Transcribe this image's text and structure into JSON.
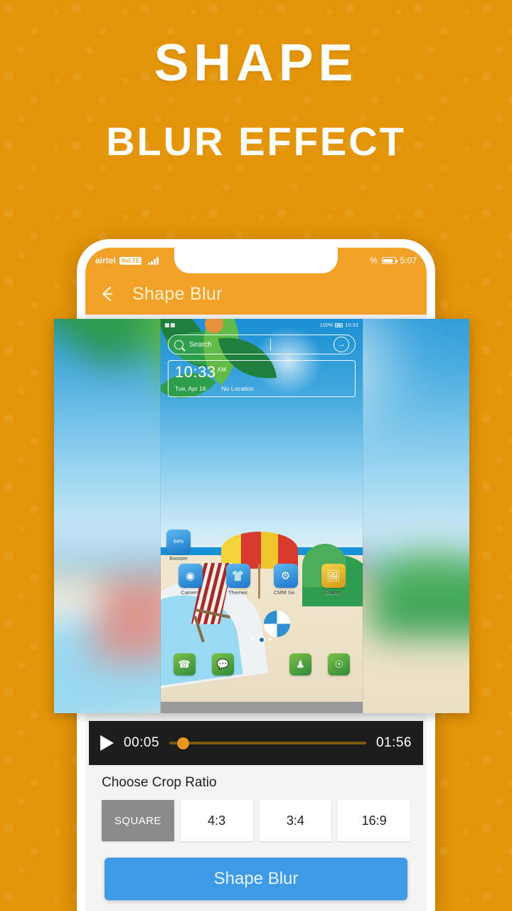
{
  "promo": {
    "headline": "SHAPE",
    "subheadline": "BLUR EFFECT",
    "background_color": "#e39408"
  },
  "phone": {
    "status_bar": {
      "carrier": "airtel",
      "volte": "VoLTE",
      "battery_text": "%",
      "time": "5:07"
    },
    "app_bar": {
      "back_icon": "arrow-left-icon",
      "title": "Shape Blur",
      "color": "#f3a229"
    }
  },
  "preview": {
    "inner_screenshot": {
      "status": {
        "battery": "100%",
        "time": "10:33"
      },
      "search": {
        "placeholder": "Search",
        "icon": "search-icon",
        "go_icon": "arrow-right-icon"
      },
      "clock_widget": {
        "time": "10:33",
        "meridiem": "AM",
        "date": "Tue, Apr 16",
        "location": "No Location"
      },
      "apps": [
        {
          "label": "Booster",
          "icon": "booster-icon",
          "badge": "64%"
        },
        {
          "label": "Camera",
          "icon": "camera-icon"
        },
        {
          "label": "Themes",
          "icon": "themes-icon"
        },
        {
          "label": "CMM Se..",
          "icon": "settings-gear-icon"
        },
        {
          "label": "Gallery",
          "icon": "gallery-icon"
        }
      ],
      "page_dots": {
        "count": 3,
        "active_index": 1
      },
      "dock": [
        {
          "icon": "phone-icon"
        },
        {
          "icon": "messages-icon"
        },
        {
          "icon": "app-drawer-icon"
        },
        {
          "icon": "contacts-icon"
        },
        {
          "icon": "browser-icon"
        }
      ]
    }
  },
  "player": {
    "play_icon": "play-icon",
    "current_time": "00:05",
    "total_time": "01:56",
    "progress_percent": 4,
    "accent_color": "#e8981d"
  },
  "crop": {
    "label": "Choose Crop Ratio",
    "options": [
      {
        "label": "SQUARE",
        "selected": true
      },
      {
        "label": "4:3",
        "selected": false
      },
      {
        "label": "3:4",
        "selected": false
      },
      {
        "label": "16:9",
        "selected": false
      }
    ]
  },
  "primary_action": {
    "label": "Shape Blur",
    "color": "#3e9ae5"
  }
}
